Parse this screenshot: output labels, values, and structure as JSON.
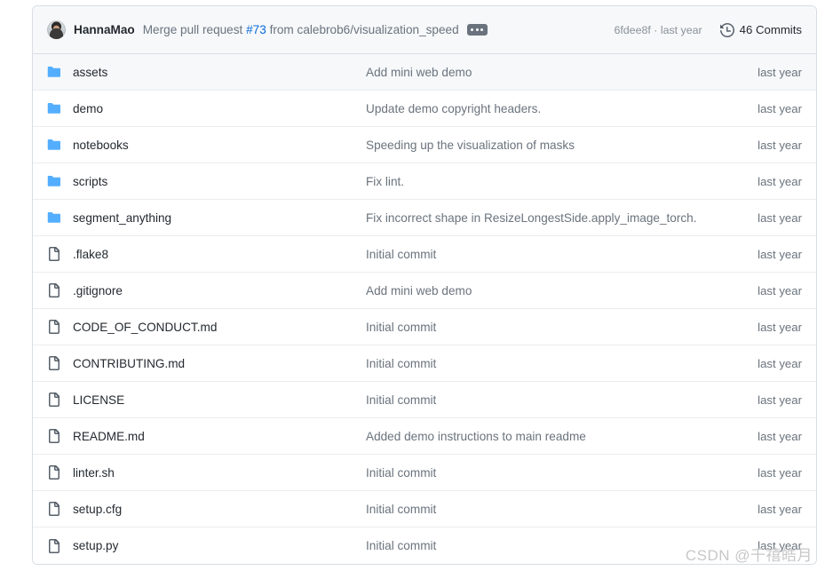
{
  "commit_header": {
    "author": "HannaMao",
    "avatar_alt": "HannaMao avatar",
    "message_prefix": "Merge pull request ",
    "pr_number": "#73",
    "message_suffix": " from calebrob6/visualization_speed",
    "expand_button_label": "...",
    "commit_sha": "6fdee8f",
    "commit_separator": " · ",
    "commit_age": "last year",
    "commits_label": "46 Commits",
    "history_icon": "history-icon"
  },
  "files": [
    {
      "type": "folder",
      "icon": "folder-icon",
      "name": "assets",
      "message": "Add mini web demo",
      "age": "last year",
      "active": true
    },
    {
      "type": "folder",
      "icon": "folder-icon",
      "name": "demo",
      "message": "Update demo copyright headers.",
      "age": "last year",
      "active": false
    },
    {
      "type": "folder",
      "icon": "folder-icon",
      "name": "notebooks",
      "message": "Speeding up the visualization of masks",
      "age": "last year",
      "active": false
    },
    {
      "type": "folder",
      "icon": "folder-icon",
      "name": "scripts",
      "message": "Fix lint.",
      "age": "last year",
      "active": false
    },
    {
      "type": "folder",
      "icon": "folder-icon",
      "name": "segment_anything",
      "message": "Fix incorrect shape in ResizeLongestSide.apply_image_torch.",
      "age": "last year",
      "active": false
    },
    {
      "type": "file",
      "icon": "file-icon",
      "name": ".flake8",
      "message": "Initial commit",
      "age": "last year",
      "active": false
    },
    {
      "type": "file",
      "icon": "file-icon",
      "name": ".gitignore",
      "message": "Add mini web demo",
      "age": "last year",
      "active": false
    },
    {
      "type": "file",
      "icon": "file-icon",
      "name": "CODE_OF_CONDUCT.md",
      "message": "Initial commit",
      "age": "last year",
      "active": false
    },
    {
      "type": "file",
      "icon": "file-icon",
      "name": "CONTRIBUTING.md",
      "message": "Initial commit",
      "age": "last year",
      "active": false
    },
    {
      "type": "file",
      "icon": "file-icon",
      "name": "LICENSE",
      "message": "Initial commit",
      "age": "last year",
      "active": false
    },
    {
      "type": "file",
      "icon": "file-icon",
      "name": "README.md",
      "message": "Added demo instructions to main readme",
      "age": "last year",
      "active": false
    },
    {
      "type": "file",
      "icon": "file-icon",
      "name": "linter.sh",
      "message": "Initial commit",
      "age": "last year",
      "active": false
    },
    {
      "type": "file",
      "icon": "file-icon",
      "name": "setup.cfg",
      "message": "Initial commit",
      "age": "last year",
      "active": false
    },
    {
      "type": "file",
      "icon": "file-icon",
      "name": "setup.py",
      "message": "Initial commit",
      "age": "last year",
      "active": false
    }
  ],
  "watermark": {
    "text": "CSDN @千禧皓月"
  },
  "colors": {
    "link": "#0969da",
    "folder_icon": "#54aeff",
    "muted_text": "#6a737d",
    "primary_text": "#24292f",
    "header_bg": "#f6f8fa",
    "border": "#d8dee4",
    "row_border": "#eaecef"
  }
}
